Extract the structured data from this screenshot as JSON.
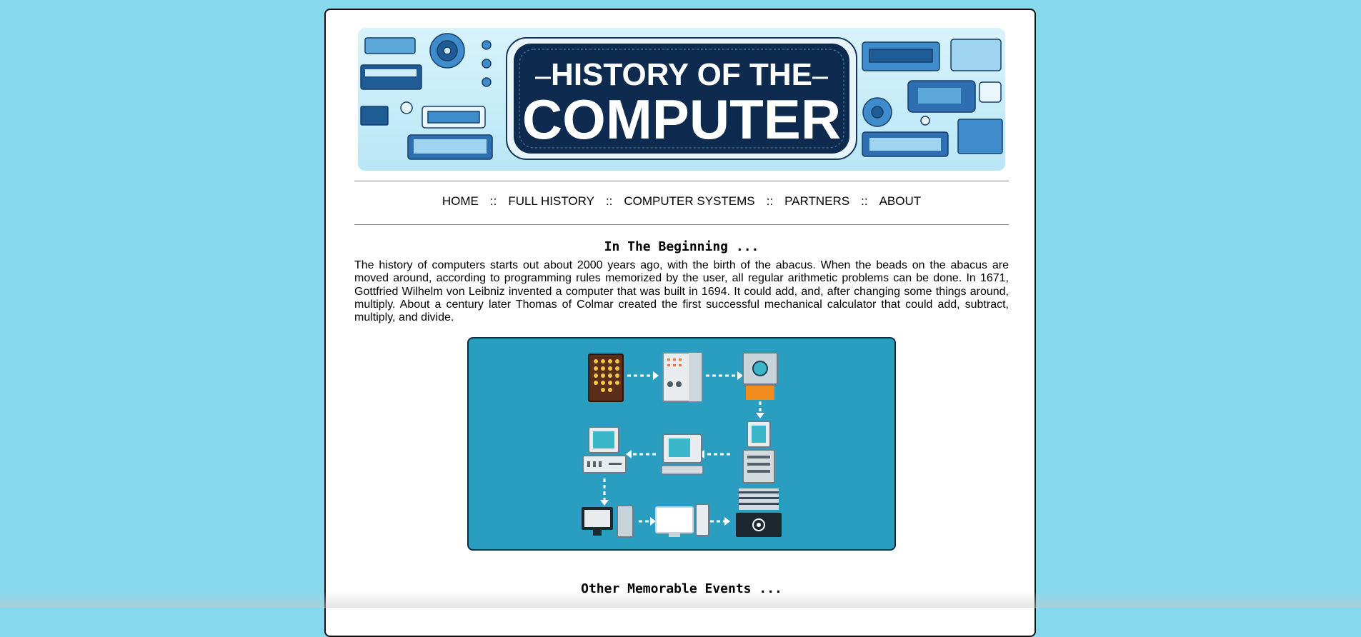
{
  "banner": {
    "title_line1": "HISTORY OF THE",
    "title_line2": "COMPUTER"
  },
  "nav": {
    "items": [
      "HOME",
      "FULL HISTORY",
      "COMPUTER SYSTEMS",
      "PARTNERS",
      "ABOUT"
    ],
    "separator": "::"
  },
  "sections": {
    "beginning_heading": "In The Beginning ...",
    "beginning_text": "The history of computers starts out about 2000 years ago, with the birth of the abacus. When the beads on the abacus are moved around, according to programming rules memorized by the user, all regular arithmetic problems can be done. In 1671, Gottfried Wilhelm von Leibniz invented a computer that was built in 1694. It could add, and, after changing some things around, multiply. About a century later Thomas of Colmar created the first successful mechanical calculator that could add, subtract, multiply, and divide.",
    "events_heading": "Other Memorable Events ..."
  },
  "colors": {
    "background": "#86d8ec",
    "diagram_bg": "#2a9ec0",
    "banner_navy": "#0f2a4f"
  }
}
